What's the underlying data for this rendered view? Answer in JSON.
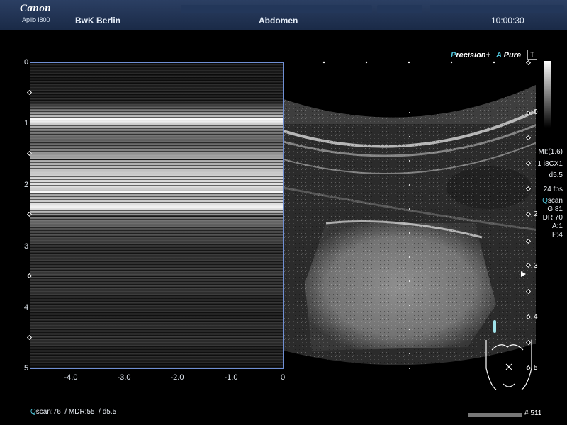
{
  "header": {
    "brand": "Canon",
    "model": "Aplio i800",
    "site": "BwK Berlin",
    "exam": "Abdomen",
    "time": "10:00:30"
  },
  "mmode": {
    "depth_labels": [
      "0",
      "1",
      "2",
      "3",
      "4",
      "5"
    ],
    "time_labels": [
      "-4.0",
      "-3.0",
      "-2.0",
      "-1.0",
      "0"
    ]
  },
  "right_panel": {
    "precision_p": "P",
    "precision_rest": "recision",
    "precision_plus": "+",
    "apure_a": "A",
    "apure_rest": " Pure",
    "depth_labels": [
      "0",
      "1",
      "2",
      "3",
      "4",
      "5"
    ],
    "mi": "MI:(1.6)",
    "probe": "1 i8CX1",
    "depth": "d5.5",
    "fps": "24 fps",
    "qscan_q": "Q",
    "qscan_rest": "scan",
    "gain": "G:81",
    "dr": "DR:70",
    "a": "A:1",
    "p": "P:4"
  },
  "footer": {
    "qscan_q": "Q",
    "qscan_rest": "scan:76",
    "params": "  / MDR:55  / d5.5",
    "frame": "# 511"
  },
  "colors": {
    "header_bg": "#1f3152",
    "mmode_border": "#6f8fd4",
    "accent_cyan": "#4fc3d9"
  }
}
